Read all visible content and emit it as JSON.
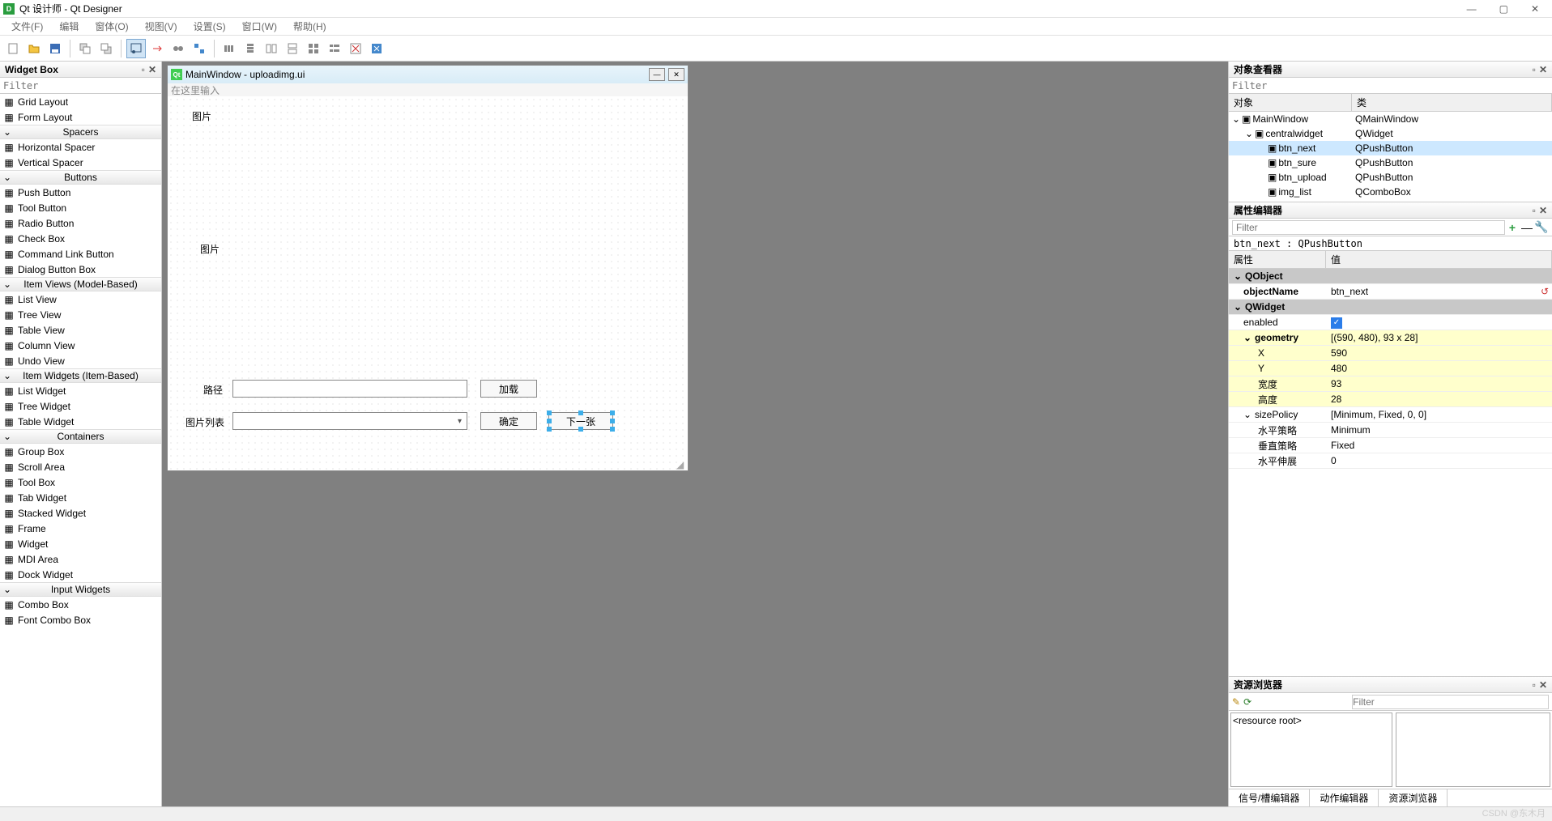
{
  "window": {
    "title": "Qt 设计师 - Qt Designer"
  },
  "menubar": [
    "文件(F)",
    "编辑",
    "窗体(O)",
    "视图(V)",
    "设置(S)",
    "窗口(W)",
    "帮助(H)"
  ],
  "widgetbox": {
    "title": "Widget Box",
    "filter_placeholder": "Filter",
    "sections": [
      {
        "name": "",
        "items": [
          "Grid Layout",
          "Form Layout"
        ]
      },
      {
        "name": "Spacers",
        "items": [
          "Horizontal Spacer",
          "Vertical Spacer"
        ]
      },
      {
        "name": "Buttons",
        "items": [
          "Push Button",
          "Tool Button",
          "Radio Button",
          "Check Box",
          "Command Link Button",
          "Dialog Button Box"
        ]
      },
      {
        "name": "Item Views (Model-Based)",
        "items": [
          "List View",
          "Tree View",
          "Table View",
          "Column View",
          "Undo View"
        ]
      },
      {
        "name": "Item Widgets (Item-Based)",
        "items": [
          "List Widget",
          "Tree Widget",
          "Table Widget"
        ]
      },
      {
        "name": "Containers",
        "items": [
          "Group Box",
          "Scroll Area",
          "Tool Box",
          "Tab Widget",
          "Stacked Widget",
          "Frame",
          "Widget",
          "MDI Area",
          "Dock Widget"
        ]
      },
      {
        "name": "Input Widgets",
        "items": [
          "Combo Box",
          "Font Combo Box"
        ]
      }
    ]
  },
  "subwindow": {
    "title": "MainWindow - uploadimg.ui",
    "menu_hint": "在这里输入",
    "labels": {
      "img1": "图片",
      "img2": "图片",
      "path": "路径",
      "list": "图片列表"
    },
    "buttons": {
      "load": "加载",
      "sure": "确定",
      "next": "下一张"
    }
  },
  "object_inspector": {
    "title": "对象查看器",
    "filter_placeholder": "Filter",
    "cols": [
      "对象",
      "类"
    ],
    "rows": [
      {
        "indent": 0,
        "name": "MainWindow",
        "cls": "QMainWindow",
        "sel": false,
        "exp": true
      },
      {
        "indent": 1,
        "name": "centralwidget",
        "cls": "QWidget",
        "sel": false,
        "exp": true
      },
      {
        "indent": 2,
        "name": "btn_next",
        "cls": "QPushButton",
        "sel": true
      },
      {
        "indent": 2,
        "name": "btn_sure",
        "cls": "QPushButton",
        "sel": false
      },
      {
        "indent": 2,
        "name": "btn_upload",
        "cls": "QPushButton",
        "sel": false
      },
      {
        "indent": 2,
        "name": "img_list",
        "cls": "QComboBox",
        "sel": false
      }
    ]
  },
  "property_editor": {
    "title": "属性编辑器",
    "filter_placeholder": "Filter",
    "obj": "btn_next : QPushButton",
    "cols": [
      "属性",
      "值"
    ],
    "groups": [
      {
        "name": "QObject",
        "rows": [
          {
            "k": "objectName",
            "v": "btn_next",
            "bold": true,
            "reset": true
          }
        ]
      },
      {
        "name": "QWidget",
        "rows": [
          {
            "k": "enabled",
            "v": "__check__",
            "mod": false
          },
          {
            "k": "geometry",
            "v": "[(590, 480), 93 x 28]",
            "mod": true,
            "exp": true,
            "bold": true
          },
          {
            "k": "X",
            "v": "590",
            "mod": true,
            "indent": 1
          },
          {
            "k": "Y",
            "v": "480",
            "mod": true,
            "indent": 1
          },
          {
            "k": "宽度",
            "v": "93",
            "mod": true,
            "indent": 1
          },
          {
            "k": "高度",
            "v": "28",
            "mod": true,
            "indent": 1
          },
          {
            "k": "sizePolicy",
            "v": "[Minimum, Fixed, 0, 0]",
            "exp": true
          },
          {
            "k": "水平策略",
            "v": "Minimum",
            "indent": 1
          },
          {
            "k": "垂直策略",
            "v": "Fixed",
            "indent": 1
          },
          {
            "k": "水平伸展",
            "v": "0",
            "indent": 1
          }
        ]
      }
    ]
  },
  "resource_browser": {
    "title": "资源浏览器",
    "filter_placeholder": "Filter",
    "root": "<resource root>",
    "tabs": [
      "信号/槽编辑器",
      "动作编辑器",
      "资源浏览器"
    ],
    "active_tab": 2
  },
  "watermark": "CSDN @东木月"
}
